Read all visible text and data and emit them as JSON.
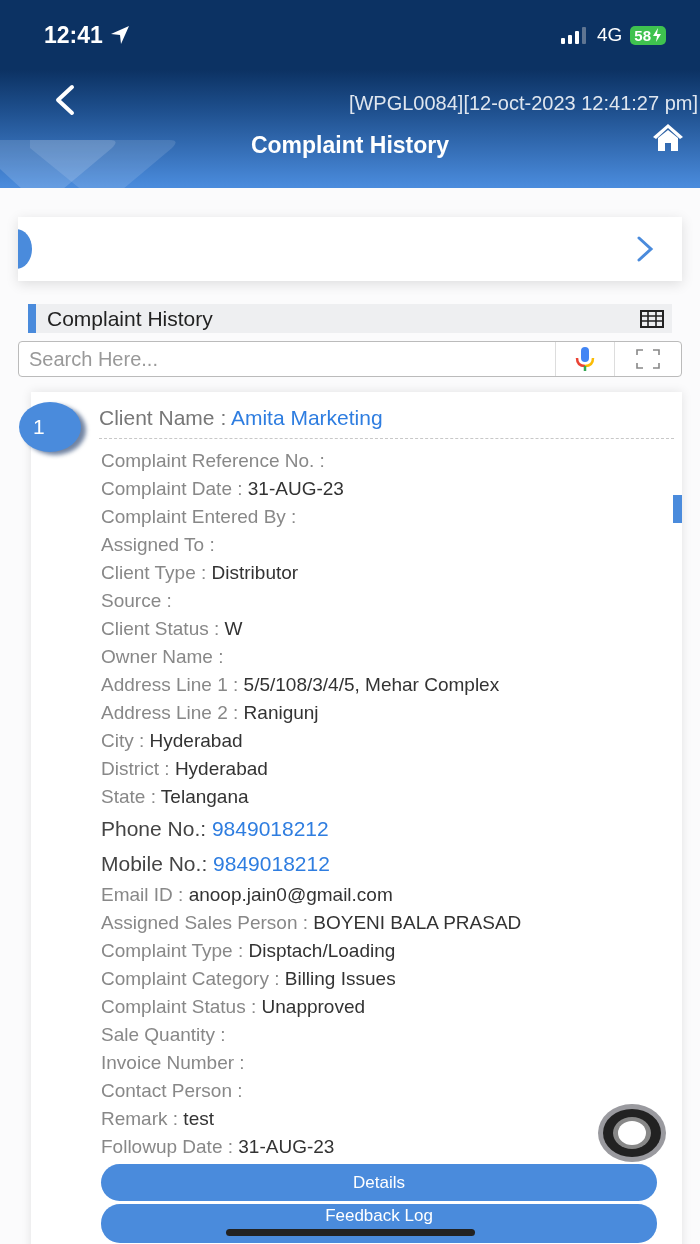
{
  "status_bar": {
    "time": "12:41",
    "network": "4G",
    "battery": "58"
  },
  "header": {
    "subtitle": "[WPGL0084][12-oct-2023 12:41:27 pm]",
    "title": "Complaint History"
  },
  "section": {
    "title": "Complaint History"
  },
  "search": {
    "placeholder": "Search Here..."
  },
  "record": {
    "index": "1",
    "client_label": "Client Name :",
    "client_name": "Amita Marketing",
    "fields": [
      {
        "kind": "plain",
        "label": "Complaint Reference No. :"
      },
      {
        "kind": "plain",
        "label": "Complaint Date :",
        "value": "31-AUG-23"
      },
      {
        "kind": "plain",
        "label": "Complaint Entered By :"
      },
      {
        "kind": "plain",
        "label": "Assigned To :"
      },
      {
        "kind": "plain",
        "label": "Client Type :",
        "value": "Distributor"
      },
      {
        "kind": "plain",
        "label": "Source :"
      },
      {
        "kind": "plain",
        "label": "Client Status :",
        "value": "W"
      },
      {
        "kind": "plain",
        "label": "Owner Name :"
      },
      {
        "kind": "plain",
        "label": "Address Line 1 :",
        "value": "5/5/108/3/4/5, Mehar Complex"
      },
      {
        "kind": "plain",
        "label": "Address Line 2 :",
        "value": "Ranigunj"
      },
      {
        "kind": "plain",
        "label": "City :",
        "value": "Hyderabad"
      },
      {
        "kind": "plain",
        "label": "District :",
        "value": "Hyderabad"
      },
      {
        "kind": "plain",
        "label": "State :",
        "value": "Telangana"
      },
      {
        "kind": "phone",
        "label": "Phone No.:",
        "value": "9849018212"
      },
      {
        "kind": "phone",
        "label": "Mobile No.:",
        "value": "9849018212"
      },
      {
        "kind": "plain",
        "label": "Email ID :",
        "value": "anoop.jain0@gmail.com"
      },
      {
        "kind": "plain",
        "label": "Assigned Sales Person :",
        "value": "BOYENI BALA PRASAD"
      },
      {
        "kind": "plain",
        "label": "Complaint Type :",
        "value": "Disptach/Loading"
      },
      {
        "kind": "plain",
        "label": "Complaint Category :",
        "value": "Billing Issues"
      },
      {
        "kind": "plain",
        "label": "Complaint Status :",
        "value": "Unapproved"
      },
      {
        "kind": "plain",
        "label": "Sale Quantity :"
      },
      {
        "kind": "plain",
        "label": "Invoice Number :"
      },
      {
        "kind": "plain",
        "label": "Contact Person :"
      },
      {
        "kind": "plain",
        "label": "Remark :",
        "value": "test"
      },
      {
        "kind": "plain",
        "label": "Followup Date :",
        "value": "31-AUG-23"
      }
    ],
    "buttons": [
      "Details",
      "Feedback Log"
    ]
  }
}
